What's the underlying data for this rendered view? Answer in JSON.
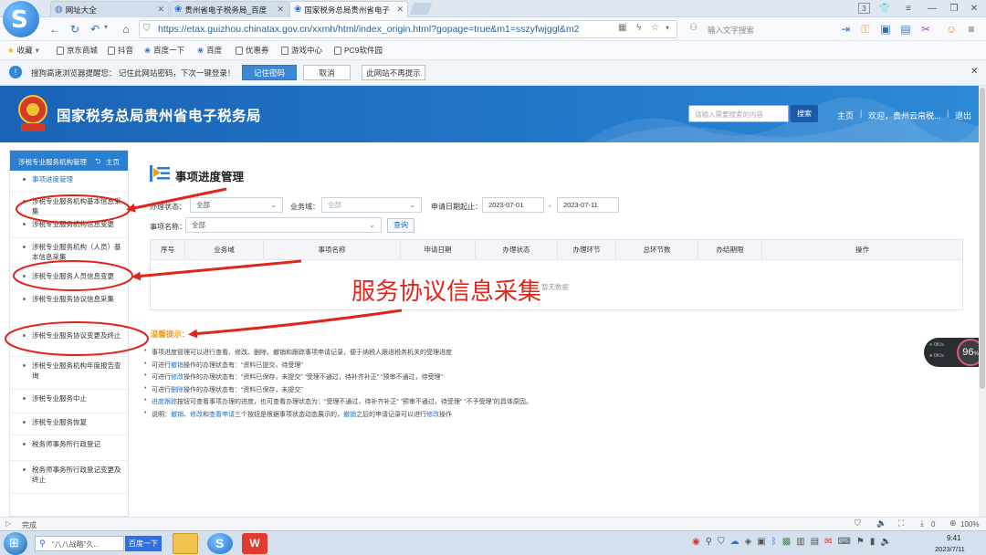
{
  "browser": {
    "tabs": [
      {
        "title": "网址大全",
        "active": false
      },
      {
        "title": "贵州省电子税务局_百度",
        "active": false
      },
      {
        "title": "国家税务总局贵州省电子",
        "active": true
      }
    ],
    "tab_count": "3",
    "url": "https://etax.guizhou.chinatax.gov.cn/xxmh/html/index_origin.html?gopage=true&m1=sszyfwjggl&m2",
    "search_placeholder": "输入文字搜索",
    "bookmarks": [
      "收藏",
      "京东商城",
      "抖音",
      "百度一下",
      "百度",
      "优惠券",
      "游戏中心",
      "PC9软件园"
    ],
    "password_bar": {
      "message": "搜狗高速浏览器提醒您： 记住此网站密码，下次一键登录！",
      "remember": "记住密码",
      "cancel": "取消",
      "never": "此网站不再提示"
    },
    "status": "完成",
    "zoom": "100%",
    "download_count": "0"
  },
  "site": {
    "title": "国家税务总局贵州省电子税务局",
    "search_placeholder": "请输入需要搜索的内容",
    "search_button": "搜索",
    "nav": [
      "主页",
      "欢迎，贵州云帛税...",
      "退出"
    ],
    "logo_caption": "中国税务"
  },
  "sidebar": {
    "header": "涉税专业服务机构管理",
    "home": "主页",
    "items": [
      {
        "label": "事项进度管理",
        "active": true
      },
      {
        "label": "涉税专业服务机构基本信息采集",
        "active": false
      },
      {
        "label": "涉税专业服务机构信息变更",
        "active": false
      },
      {
        "label": "涉税专业服务机构（人员）基本信息采集",
        "active": false
      },
      {
        "label": "涉税专业服务人员信息变更",
        "active": false
      },
      {
        "label": "涉税专业服务协议信息采集",
        "active": false
      },
      {
        "label": "涉税专业服务协议变更及终止",
        "active": false
      },
      {
        "label": "涉税专业服务机构年度报告查询",
        "active": false
      },
      {
        "label": "涉税专业服务中止",
        "active": false
      },
      {
        "label": "涉税专业服务恢复",
        "active": false
      },
      {
        "label": "税务师事务所行政登记",
        "active": false
      },
      {
        "label": "税务师事务所行政登记变更及终止",
        "active": false
      }
    ]
  },
  "main": {
    "title": "事项进度管理",
    "filters": {
      "status_label": "办理状态：",
      "status_value": "全部",
      "domain_label": "业务域：",
      "domain_value": "全部",
      "date_label": "申请日期起止：",
      "date_from": "2023-07-01",
      "date_sep": "-",
      "date_to": "2023-07-11",
      "item_label": "事项名称：",
      "item_value": "全部",
      "query_button": "查询"
    },
    "table": {
      "columns": [
        "序号",
        "业务域",
        "事项名称",
        "申请日期",
        "办理状态",
        "办理环节",
        "总环节数",
        "办结期限",
        "操作"
      ],
      "empty_text": "暂无数据"
    },
    "notes_heading": "温馨提示：",
    "notes": [
      {
        "segments": [
          {
            "t": "事项进度管理可以进行查看、修改、删除、撤销和跟踪事项申请记录，便于纳税人跟进税务机关的受理进度",
            "link": false
          }
        ]
      },
      {
        "segments": [
          {
            "t": "可进行",
            "link": false
          },
          {
            "t": "撤销",
            "link": true
          },
          {
            "t": "操作的办理状态有：“资料已提交，待受理”",
            "link": false
          }
        ]
      },
      {
        "segments": [
          {
            "t": "可进行",
            "link": false
          },
          {
            "t": "修改",
            "link": true
          },
          {
            "t": "操作的办理状态有：“资料已保存，未提交”  “受理不通过，待补齐补正”  “预审不通过，待受理”",
            "link": false
          }
        ]
      },
      {
        "segments": [
          {
            "t": "可进行",
            "link": false
          },
          {
            "t": "删除",
            "link": true
          },
          {
            "t": "操作的办理状态有：“资料已保存，未提交”",
            "link": false
          }
        ]
      },
      {
        "segments": [
          {
            "t": "进度跟踪",
            "link": true
          },
          {
            "t": "按钮可查看事项办理的进度，也可查看办理状态为：“受理不通过，待补齐补正”  “预审不通过，待受理”  “不予受理”的具体原因。",
            "link": false
          }
        ]
      },
      {
        "segments": [
          {
            "t": "说明：",
            "link": false
          },
          {
            "t": "撤销",
            "link": true
          },
          {
            "t": "、",
            "link": false
          },
          {
            "t": "修改",
            "link": true
          },
          {
            "t": "和",
            "link": false
          },
          {
            "t": "查看申请",
            "link": true
          },
          {
            "t": "三个按钮是根据事项状态动态展示的，",
            "link": false
          },
          {
            "t": "撤销",
            "link": true
          },
          {
            "t": "之后的申请记录可以进行",
            "link": false
          },
          {
            "t": "修改",
            "link": true
          },
          {
            "t": "操作",
            "link": false
          }
        ]
      }
    ]
  },
  "annotation": {
    "text": "服务协议信息采集",
    "color": "#e0251b"
  },
  "widget": {
    "percent": "96",
    "up": "0K/s",
    "down": "0K/s"
  },
  "taskbar": {
    "search_text": "“八八战略”久...",
    "search_button": "百度一下",
    "time": "9:41",
    "date": "2023/7/11"
  },
  "colors": {
    "header_blue": "#2277c9",
    "link_blue": "#1e6fc4",
    "accent_orange": "#f39a1a"
  }
}
